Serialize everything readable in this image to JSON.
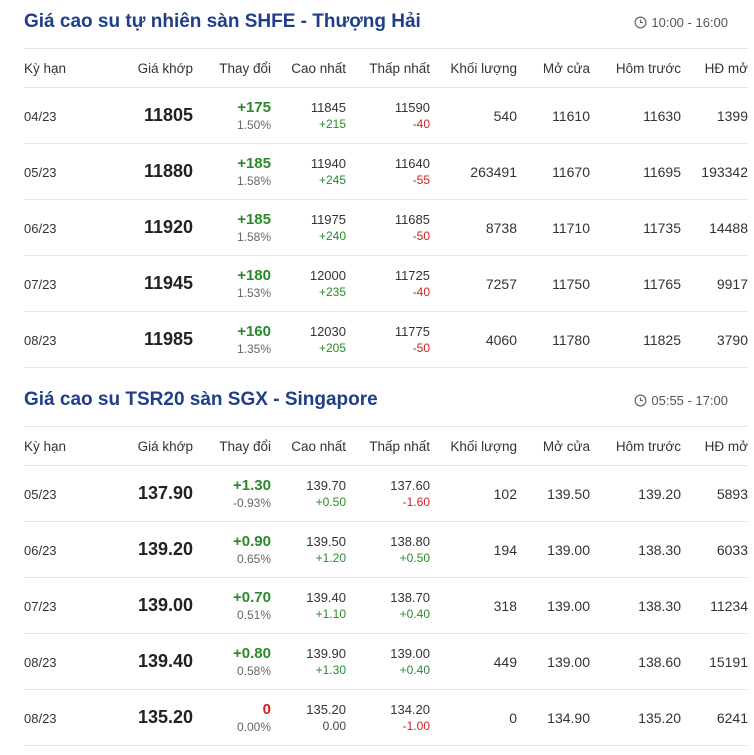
{
  "sections": [
    {
      "title": "Giá cao su tự nhiên sàn SHFE - Thượng Hải",
      "time": "10:00 - 16:00",
      "headers": [
        "Kỳ hạn",
        "Giá khớp",
        "Thay đổi",
        "Cao nhất",
        "Thấp nhất",
        "Khối lượng",
        "Mở cửa",
        "Hôm trước",
        "HĐ mở"
      ],
      "rows": [
        {
          "term": "04/23",
          "price": "11805",
          "change": "+175",
          "change_pct": "1.50%",
          "high": "11845",
          "high_chg": "+215",
          "low": "11590",
          "low_chg": "-40",
          "volume": "540",
          "open": "11610",
          "prev": "11630",
          "oi": "1399"
        },
        {
          "term": "05/23",
          "price": "11880",
          "change": "+185",
          "change_pct": "1.58%",
          "high": "11940",
          "high_chg": "+245",
          "low": "11640",
          "low_chg": "-55",
          "volume": "263491",
          "open": "11670",
          "prev": "11695",
          "oi": "193342"
        },
        {
          "term": "06/23",
          "price": "11920",
          "change": "+185",
          "change_pct": "1.58%",
          "high": "11975",
          "high_chg": "+240",
          "low": "11685",
          "low_chg": "-50",
          "volume": "8738",
          "open": "11710",
          "prev": "11735",
          "oi": "14488"
        },
        {
          "term": "07/23",
          "price": "11945",
          "change": "+180",
          "change_pct": "1.53%",
          "high": "12000",
          "high_chg": "+235",
          "low": "11725",
          "low_chg": "-40",
          "volume": "7257",
          "open": "11750",
          "prev": "11765",
          "oi": "9917"
        },
        {
          "term": "08/23",
          "price": "11985",
          "change": "+160",
          "change_pct": "1.35%",
          "high": "12030",
          "high_chg": "+205",
          "low": "11775",
          "low_chg": "-50",
          "volume": "4060",
          "open": "11780",
          "prev": "11825",
          "oi": "3790"
        }
      ]
    },
    {
      "title": "Giá cao su TSR20 sàn SGX - Singapore",
      "time": "05:55 - 17:00",
      "headers": [
        "Kỳ hạn",
        "Giá khớp",
        "Thay đổi",
        "Cao nhất",
        "Thấp nhất",
        "Khối lượng",
        "Mở cửa",
        "Hôm trước",
        "HĐ mở"
      ],
      "rows": [
        {
          "term": "05/23",
          "price": "137.90",
          "change": "+1.30",
          "change_pct": "-0.93%",
          "high": "139.70",
          "high_chg": "+0.50",
          "low": "137.60",
          "low_chg": "-1.60",
          "volume": "102",
          "open": "139.50",
          "prev": "139.20",
          "oi": "5893"
        },
        {
          "term": "06/23",
          "price": "139.20",
          "change": "+0.90",
          "change_pct": "0.65%",
          "high": "139.50",
          "high_chg": "+1.20",
          "low": "138.80",
          "low_chg": "+0.50",
          "volume": "194",
          "open": "139.00",
          "prev": "138.30",
          "oi": "6033"
        },
        {
          "term": "07/23",
          "price": "139.00",
          "change": "+0.70",
          "change_pct": "0.51%",
          "high": "139.40",
          "high_chg": "+1.10",
          "low": "138.70",
          "low_chg": "+0.40",
          "volume": "318",
          "open": "139.00",
          "prev": "138.30",
          "oi": "11234"
        },
        {
          "term": "08/23",
          "price": "139.40",
          "change": "+0.80",
          "change_pct": "0.58%",
          "high": "139.90",
          "high_chg": "+1.30",
          "low": "139.00",
          "low_chg": "+0.40",
          "volume": "449",
          "open": "139.00",
          "prev": "138.60",
          "oi": "15191"
        },
        {
          "term": "08/23",
          "price": "135.20",
          "change": "0",
          "change_pct": "0.00%",
          "high": "135.20",
          "high_chg": "0.00",
          "low": "134.20",
          "low_chg": "-1.00",
          "volume": "0",
          "open": "134.90",
          "prev": "135.20",
          "oi": "6241"
        }
      ]
    }
  ],
  "colors": {
    "title": "#1f3f8a",
    "up": "#2a8a2a",
    "down": "#d62020",
    "flat": "#444444"
  },
  "icons": {
    "time": "clock-icon"
  }
}
